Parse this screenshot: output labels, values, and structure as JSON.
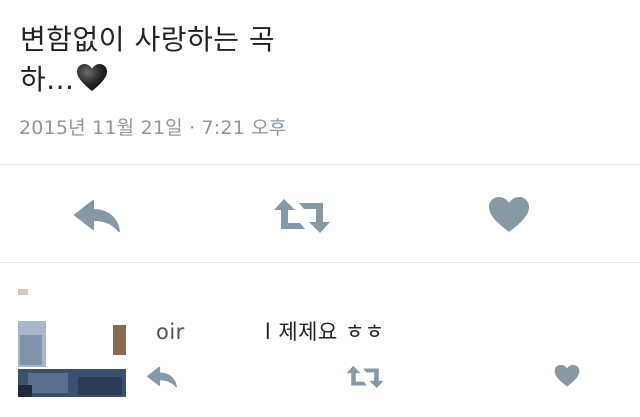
{
  "tweet": {
    "text_line1": "변함없이 사랑하는 곡",
    "text_line2": "하...",
    "heart_emoji": "black-heart-icon",
    "timestamp": "2015년 11월 21일 · 7:21 오후"
  },
  "actions": {
    "reply_icon": "reply-icon",
    "retweet_icon": "retweet-icon",
    "like_icon": "heart-icon"
  },
  "reply": {
    "text_prefix": "oir",
    "text_body": "l 제제요 ㅎㅎ"
  },
  "colors": {
    "text": "#1f2326",
    "muted": "#8899a6",
    "icon": "#8899a6",
    "divider": "#e1e8ed"
  }
}
